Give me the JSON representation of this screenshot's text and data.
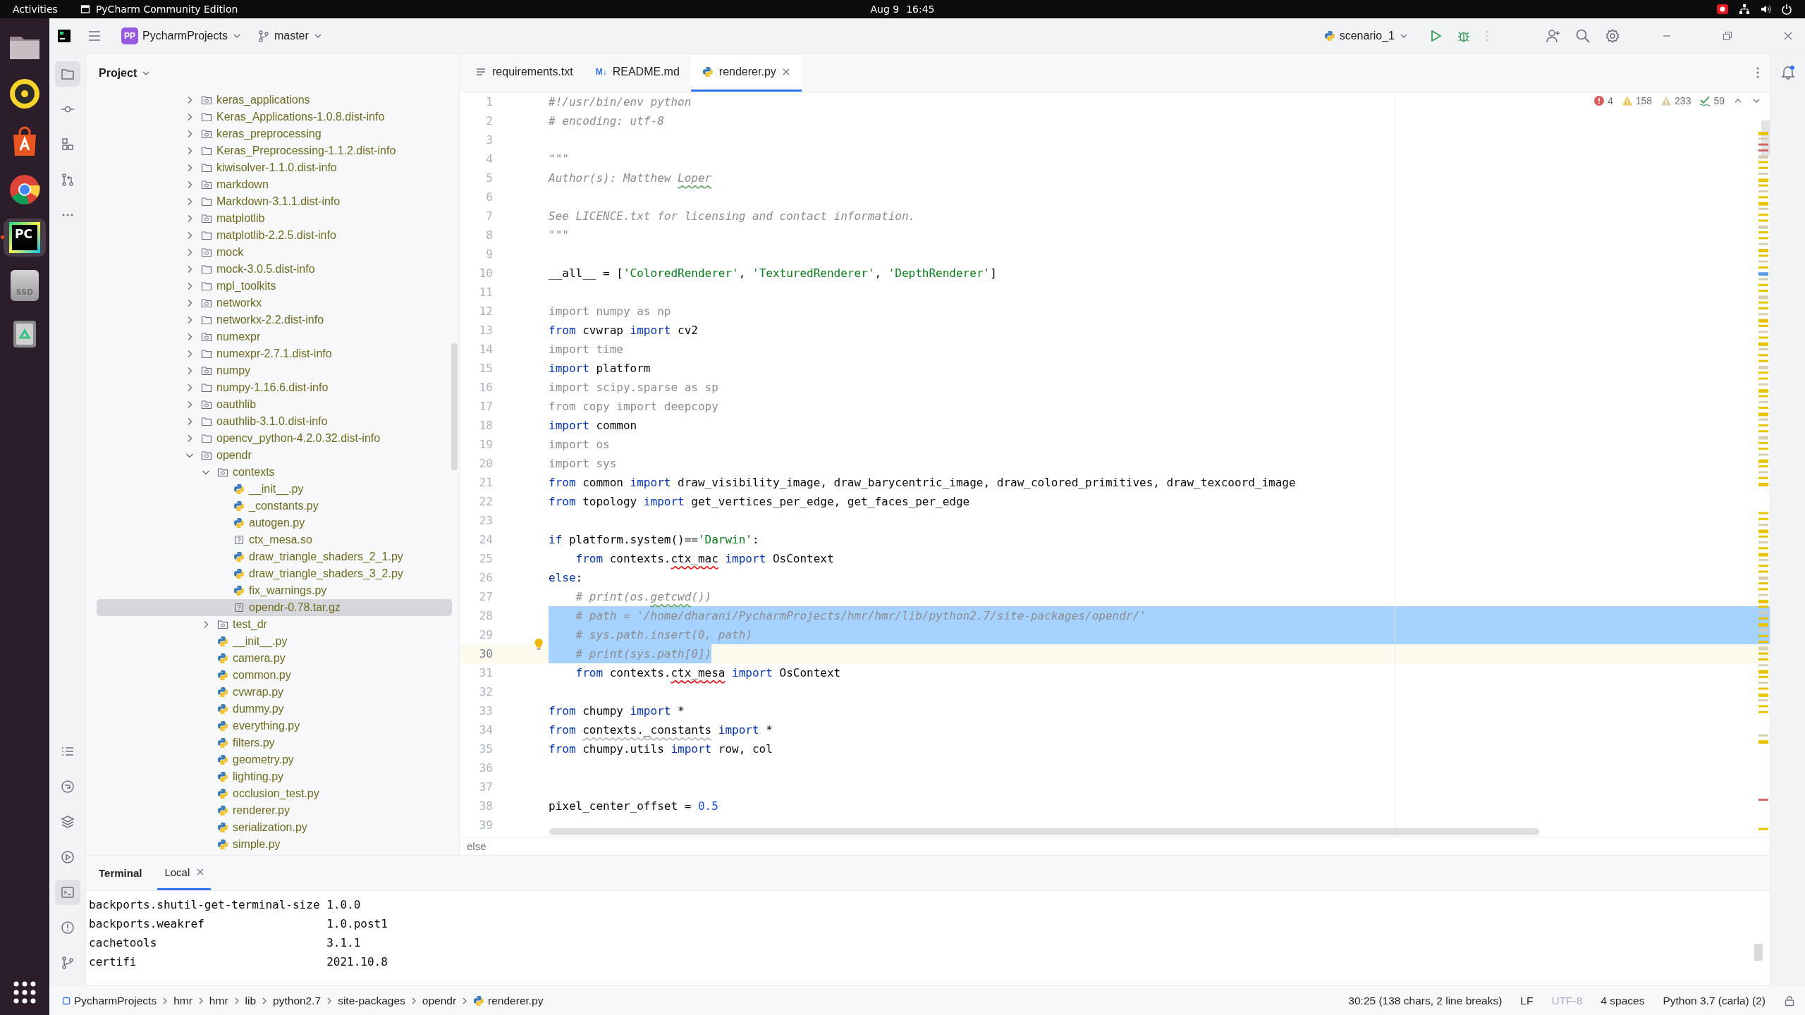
{
  "os_bar": {
    "activities": "Activities",
    "app": "PyCharm Community Edition",
    "date": "Aug 9",
    "time": "16:45"
  },
  "dock": [
    {
      "kind": "files",
      "active": false
    },
    {
      "kind": "music",
      "active": false
    },
    {
      "kind": "store",
      "active": false
    },
    {
      "kind": "browser",
      "active": false
    },
    {
      "kind": "ide",
      "label": "PC",
      "active": true
    },
    {
      "kind": "drive",
      "label": "SSD",
      "active": false
    },
    {
      "kind": "trash",
      "active": false
    },
    {
      "kind": "apps",
      "active": false
    }
  ],
  "header": {
    "project_badge": "PP",
    "project": "PycharmProjects",
    "branch": "master",
    "run_config": "scenario_1"
  },
  "tool_strip": {
    "top": [
      {
        "kind": "project",
        "selected": true
      },
      {
        "kind": "commit",
        "selected": false
      },
      {
        "kind": "structure",
        "selected": false
      },
      {
        "kind": "pull-requests",
        "selected": false
      },
      {
        "kind": "more",
        "selected": false
      }
    ],
    "bottom": [
      {
        "kind": "todo",
        "selected": false
      },
      {
        "kind": "python-console",
        "selected": false
      },
      {
        "kind": "packages",
        "selected": false
      },
      {
        "kind": "services",
        "selected": false
      },
      {
        "kind": "terminal",
        "selected": true
      },
      {
        "kind": "problems",
        "selected": false
      },
      {
        "kind": "git",
        "selected": false
      }
    ]
  },
  "project": {
    "title": "Project",
    "tree": [
      {
        "kind": "package",
        "label": "keras_applications",
        "expanded": false,
        "selected": false
      },
      {
        "kind": "folder",
        "label": "Keras_Applications-1.0.8.dist-info",
        "expanded": false,
        "selected": false
      },
      {
        "kind": "package",
        "label": "keras_preprocessing",
        "expanded": false,
        "selected": false
      },
      {
        "kind": "folder",
        "label": "Keras_Preprocessing-1.1.2.dist-info",
        "expanded": false,
        "selected": false
      },
      {
        "kind": "folder",
        "label": "kiwisolver-1.1.0.dist-info",
        "expanded": false,
        "selected": false
      },
      {
        "kind": "package",
        "label": "markdown",
        "expanded": false,
        "selected": false
      },
      {
        "kind": "folder",
        "label": "Markdown-3.1.1.dist-info",
        "expanded": false,
        "selected": false
      },
      {
        "kind": "package",
        "label": "matplotlib",
        "expanded": false,
        "selected": false
      },
      {
        "kind": "folder",
        "label": "matplotlib-2.2.5.dist-info",
        "expanded": false,
        "selected": false
      },
      {
        "kind": "package",
        "label": "mock",
        "expanded": false,
        "selected": false
      },
      {
        "kind": "folder",
        "label": "mock-3.0.5.dist-info",
        "expanded": false,
        "selected": false
      },
      {
        "kind": "folder",
        "label": "mpl_toolkits",
        "expanded": false,
        "selected": false
      },
      {
        "kind": "package",
        "label": "networkx",
        "expanded": false,
        "selected": false
      },
      {
        "kind": "folder",
        "label": "networkx-2.2.dist-info",
        "expanded": false,
        "selected": false
      },
      {
        "kind": "package",
        "label": "numexpr",
        "expanded": false,
        "selected": false
      },
      {
        "kind": "folder",
        "label": "numexpr-2.7.1.dist-info",
        "expanded": false,
        "selected": false
      },
      {
        "kind": "package",
        "label": "numpy",
        "expanded": false,
        "selected": false
      },
      {
        "kind": "folder",
        "label": "numpy-1.16.6.dist-info",
        "expanded": false,
        "selected": false
      },
      {
        "kind": "package",
        "label": "oauthlib",
        "expanded": false,
        "selected": false
      },
      {
        "kind": "folder",
        "label": "oauthlib-3.1.0.dist-info",
        "expanded": false,
        "selected": false
      },
      {
        "kind": "folder",
        "label": "opencv_python-4.2.0.32.dist-info",
        "expanded": false,
        "selected": false
      },
      {
        "kind": "package",
        "label": "opendr",
        "expanded": true,
        "selected": false,
        "children": [
          {
            "kind": "package",
            "label": "contexts",
            "expanded": true,
            "selected": false,
            "children": [
              {
                "kind": "python",
                "label": "__init__.py",
                "selected": false
              },
              {
                "kind": "python",
                "label": "_constants.py",
                "selected": false
              },
              {
                "kind": "python",
                "label": "autogen.py",
                "selected": false
              },
              {
                "kind": "unknown",
                "label": "ctx_mesa.so",
                "selected": false
              },
              {
                "kind": "python",
                "label": "draw_triangle_shaders_2_1.py",
                "selected": false
              },
              {
                "kind": "python",
                "label": "draw_triangle_shaders_3_2.py",
                "selected": false
              },
              {
                "kind": "python",
                "label": "fix_warnings.py",
                "selected": false
              },
              {
                "kind": "unknown",
                "label": "opendr-0.78.tar.gz",
                "selected": true
              }
            ]
          },
          {
            "kind": "package",
            "label": "test_dr",
            "expanded": false,
            "selected": false
          },
          {
            "kind": "python",
            "label": "__init__.py",
            "selected": false
          },
          {
            "kind": "python",
            "label": "camera.py",
            "selected": false
          },
          {
            "kind": "python",
            "label": "common.py",
            "selected": false
          },
          {
            "kind": "python",
            "label": "cvwrap.py",
            "selected": false
          },
          {
            "kind": "python",
            "label": "dummy.py",
            "selected": false
          },
          {
            "kind": "python",
            "label": "everything.py",
            "selected": false
          },
          {
            "kind": "python",
            "label": "filters.py",
            "selected": false
          },
          {
            "kind": "python",
            "label": "geometry.py",
            "selected": false
          },
          {
            "kind": "python",
            "label": "lighting.py",
            "selected": false
          },
          {
            "kind": "python",
            "label": "occlusion_test.py",
            "selected": false
          },
          {
            "kind": "python",
            "label": "renderer.py",
            "selected": false
          },
          {
            "kind": "python",
            "label": "serialization.py",
            "selected": false
          },
          {
            "kind": "python",
            "label": "simple.py",
            "selected": false
          }
        ]
      }
    ]
  },
  "editor": {
    "tabs": [
      {
        "kind": "text",
        "label": "requirements.txt",
        "selected": false
      },
      {
        "kind": "markdown",
        "badge": "M↓",
        "label": "README.md",
        "selected": false
      },
      {
        "kind": "python",
        "label": "renderer.py",
        "selected": true
      }
    ],
    "inspections": [
      {
        "kind": "error",
        "count": "4"
      },
      {
        "kind": "warning",
        "count": "158"
      },
      {
        "kind": "weak",
        "count": "233"
      },
      {
        "kind": "typo",
        "count": "59"
      }
    ],
    "lines": [
      {
        "number": "1",
        "selected": false,
        "current": false,
        "bulb": false,
        "tokens": [
          {
            "kind": "comment",
            "text": "#!/usr/bin/env python"
          }
        ]
      },
      {
        "number": "2",
        "selected": false,
        "current": false,
        "bulb": false,
        "tokens": [
          {
            "kind": "comment",
            "text": "# encoding: utf-8"
          }
        ]
      },
      {
        "number": "3",
        "selected": false,
        "current": false,
        "bulb": false
      },
      {
        "number": "4",
        "selected": false,
        "current": false,
        "bulb": false,
        "tokens": [
          {
            "kind": "comment",
            "text": "\"\"\""
          }
        ]
      },
      {
        "number": "5",
        "selected": false,
        "current": false,
        "bulb": false,
        "tokens": [
          {
            "kind": "comment",
            "text": "Author(s): Matthew "
          },
          {
            "kind": "typo",
            "text": "Loper"
          }
        ]
      },
      {
        "number": "6",
        "selected": false,
        "current": false,
        "bulb": false
      },
      {
        "number": "7",
        "selected": false,
        "current": false,
        "bulb": false,
        "tokens": [
          {
            "kind": "comment",
            "text": "See LICENCE.txt for licensing and contact information."
          }
        ]
      },
      {
        "number": "8",
        "selected": false,
        "current": false,
        "bulb": false,
        "tokens": [
          {
            "kind": "comment",
            "text": "\"\"\""
          }
        ]
      },
      {
        "number": "9",
        "selected": false,
        "current": false,
        "bulb": false
      },
      {
        "number": "10",
        "selected": false,
        "current": false,
        "bulb": false,
        "tokens": [
          {
            "kind": "text",
            "text": "__all__ = ["
          },
          {
            "kind": "string",
            "text": "'ColoredRenderer'"
          },
          {
            "kind": "text",
            "text": ", "
          },
          {
            "kind": "string",
            "text": "'TexturedRenderer'"
          },
          {
            "kind": "text",
            "text": ", "
          },
          {
            "kind": "string",
            "text": "'DepthRenderer'"
          },
          {
            "kind": "text",
            "text": "]"
          }
        ]
      },
      {
        "number": "11",
        "selected": false,
        "current": false,
        "bulb": false
      },
      {
        "number": "12",
        "selected": false,
        "current": false,
        "bulb": false,
        "tokens": [
          {
            "kind": "unused",
            "text": "import numpy as np"
          }
        ]
      },
      {
        "number": "13",
        "selected": false,
        "current": false,
        "bulb": false,
        "tokens": [
          {
            "kind": "keyword",
            "text": "from"
          },
          {
            "kind": "text",
            "text": " cvwrap "
          },
          {
            "kind": "keyword",
            "text": "import"
          },
          {
            "kind": "text",
            "text": " cv2"
          }
        ]
      },
      {
        "number": "14",
        "selected": false,
        "current": false,
        "bulb": false,
        "tokens": [
          {
            "kind": "unused",
            "text": "import time"
          }
        ]
      },
      {
        "number": "15",
        "selected": false,
        "current": false,
        "bulb": false,
        "tokens": [
          {
            "kind": "keyword",
            "text": "import"
          },
          {
            "kind": "text",
            "text": " platform"
          }
        ]
      },
      {
        "number": "16",
        "selected": false,
        "current": false,
        "bulb": false,
        "tokens": [
          {
            "kind": "unused",
            "text": "import scipy.sparse as sp"
          }
        ]
      },
      {
        "number": "17",
        "selected": false,
        "current": false,
        "bulb": false,
        "tokens": [
          {
            "kind": "unused",
            "text": "from copy import deepcopy"
          }
        ]
      },
      {
        "number": "18",
        "selected": false,
        "current": false,
        "bulb": false,
        "tokens": [
          {
            "kind": "keyword",
            "text": "import"
          },
          {
            "kind": "text",
            "text": " common"
          }
        ]
      },
      {
        "number": "19",
        "selected": false,
        "current": false,
        "bulb": false,
        "tokens": [
          {
            "kind": "unused",
            "text": "import os"
          }
        ]
      },
      {
        "number": "20",
        "selected": false,
        "current": false,
        "bulb": false,
        "tokens": [
          {
            "kind": "unused",
            "text": "import sys"
          }
        ]
      },
      {
        "number": "21",
        "selected": false,
        "current": false,
        "bulb": false,
        "tokens": [
          {
            "kind": "keyword",
            "text": "from"
          },
          {
            "kind": "text",
            "text": " common "
          },
          {
            "kind": "keyword",
            "text": "import"
          },
          {
            "kind": "text",
            "text": " draw_visibility_image, draw_barycentric_image, draw_colored_primitives, draw_texcoord_image"
          }
        ]
      },
      {
        "number": "22",
        "selected": false,
        "current": false,
        "bulb": false,
        "tokens": [
          {
            "kind": "keyword",
            "text": "from"
          },
          {
            "kind": "text",
            "text": " topology "
          },
          {
            "kind": "keyword",
            "text": "import"
          },
          {
            "kind": "text",
            "text": " get_vertices_per_edge, get_faces_per_edge"
          }
        ]
      },
      {
        "number": "23",
        "selected": false,
        "current": false,
        "bulb": false
      },
      {
        "number": "24",
        "selected": false,
        "current": false,
        "bulb": false,
        "tokens": [
          {
            "kind": "keyword",
            "text": "if"
          },
          {
            "kind": "text",
            "text": " platform.system()=="
          },
          {
            "kind": "string",
            "text": "'Darwin'"
          },
          {
            "kind": "text",
            "text": ":"
          }
        ]
      },
      {
        "number": "25",
        "selected": false,
        "current": false,
        "bulb": false,
        "tokens": [
          {
            "kind": "keyword",
            "text": "    from"
          },
          {
            "kind": "text",
            "text": " contexts."
          },
          {
            "kind": "error",
            "text": "ctx_mac"
          },
          {
            "kind": "keyword",
            "text": " import"
          },
          {
            "kind": "text",
            "text": " OsContext"
          }
        ]
      },
      {
        "number": "26",
        "selected": false,
        "current": false,
        "bulb": false,
        "tokens": [
          {
            "kind": "keyword",
            "text": "else"
          },
          {
            "kind": "text",
            "text": ":"
          }
        ]
      },
      {
        "number": "27",
        "selected": false,
        "current": false,
        "bulb": false,
        "tokens": [
          {
            "kind": "comment",
            "text": "    # print(os."
          },
          {
            "kind": "typo",
            "text": "getcwd"
          },
          {
            "kind": "comment",
            "text": "())"
          }
        ]
      },
      {
        "number": "28",
        "selected": true,
        "current": false,
        "bulb": false,
        "tokens": [
          {
            "kind": "comment",
            "text": "    # path = '/home/dharani/PycharmProjects/hmr/hmr/lib/python2.7/site-packages/opendr/'"
          }
        ]
      },
      {
        "number": "29",
        "selected": true,
        "current": false,
        "bulb": true,
        "tokens": [
          {
            "kind": "comment",
            "text": "    # sys.path.insert(0, path)"
          }
        ]
      },
      {
        "number": "30",
        "selected": true,
        "current": true,
        "bulb": false,
        "tokens": [
          {
            "kind": "comment",
            "text": "    # print(sys.path[0])"
          }
        ]
      },
      {
        "number": "31",
        "selected": false,
        "current": false,
        "bulb": false,
        "tokens": [
          {
            "kind": "keyword",
            "text": "    from"
          },
          {
            "kind": "text",
            "text": " contexts."
          },
          {
            "kind": "error",
            "text": "ctx_mesa"
          },
          {
            "kind": "keyword",
            "text": " import"
          },
          {
            "kind": "text",
            "text": " OsContext"
          }
        ]
      },
      {
        "number": "32",
        "selected": false,
        "current": false,
        "bulb": false
      },
      {
        "number": "33",
        "selected": false,
        "current": false,
        "bulb": false,
        "tokens": [
          {
            "kind": "keyword",
            "text": "from"
          },
          {
            "kind": "text",
            "text": " chumpy "
          },
          {
            "kind": "keyword",
            "text": "import"
          },
          {
            "kind": "text",
            "text": " *"
          }
        ]
      },
      {
        "number": "34",
        "selected": false,
        "current": false,
        "bulb": false,
        "tokens": [
          {
            "kind": "keyword",
            "text": "from "
          },
          {
            "kind": "weak",
            "text": "contexts._constants"
          },
          {
            "kind": "keyword",
            "text": " import"
          },
          {
            "kind": "text",
            "text": " *"
          }
        ]
      },
      {
        "number": "35",
        "selected": false,
        "current": false,
        "bulb": false,
        "tokens": [
          {
            "kind": "keyword",
            "text": "from"
          },
          {
            "kind": "text",
            "text": " chumpy.utils "
          },
          {
            "kind": "keyword",
            "text": "import"
          },
          {
            "kind": "text",
            "text": " row, col"
          }
        ]
      },
      {
        "number": "36",
        "selected": false,
        "current": false,
        "bulb": false
      },
      {
        "number": "37",
        "selected": false,
        "current": false,
        "bulb": false
      },
      {
        "number": "38",
        "selected": false,
        "current": false,
        "bulb": false,
        "tokens": [
          {
            "kind": "text",
            "text": "pixel_center_offset = "
          },
          {
            "kind": "number",
            "text": "0.5"
          }
        ]
      },
      {
        "number": "39",
        "selected": false,
        "current": false,
        "bulb": false
      }
    ],
    "breadcrumb": "else"
  },
  "terminal": {
    "title": "Terminal",
    "tabs": [
      {
        "label": "Local",
        "selected": true
      }
    ],
    "lines": [
      "backports.shutil-get-terminal-size 1.0.0",
      "backports.weakref                  1.0.post1",
      "cachetools                         3.1.1",
      "certifi                            2021.10.8"
    ]
  },
  "status_bar": {
    "path": [
      {
        "kind": "project",
        "label": "PycharmProjects"
      },
      {
        "kind": "folder",
        "label": "hmr"
      },
      {
        "kind": "folder",
        "label": "hmr"
      },
      {
        "kind": "folder",
        "label": "lib"
      },
      {
        "kind": "folder",
        "label": "python2.7"
      },
      {
        "kind": "folder",
        "label": "site-packages"
      },
      {
        "kind": "folder",
        "label": "opendr"
      },
      {
        "kind": "python",
        "label": "renderer.py"
      }
    ],
    "position": "30:25 (138 chars, 2 line breaks)",
    "line_separator": "LF",
    "encoding": {
      "label": "UTF-8",
      "disabled": true
    },
    "indent": "4 spaces",
    "interpreter": "Python 3.7 (carla) (2)"
  }
}
